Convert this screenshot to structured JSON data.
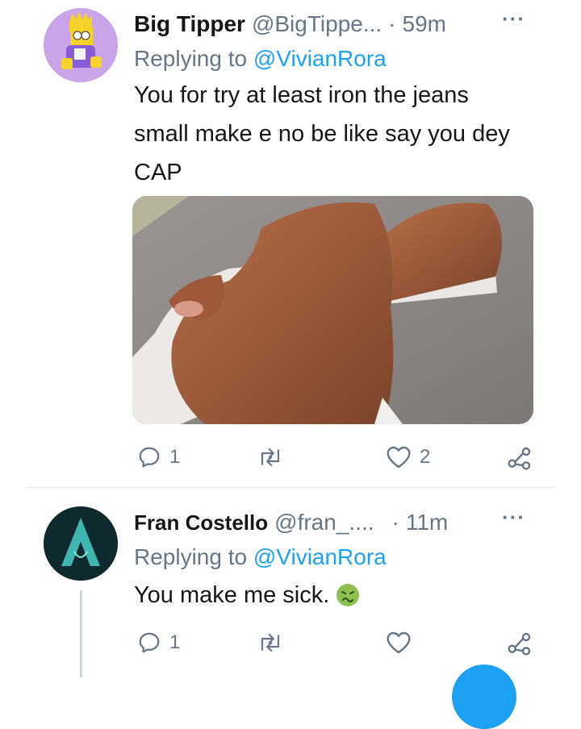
{
  "tweet1": {
    "display_name": "Big Tipper",
    "handle": "@BigTippe...",
    "separator": "·",
    "time": "59m",
    "more": "···",
    "replying_prefix": "Replying to",
    "replying_to": "@VivianRora",
    "text": "You for try at least iron the jeans small make e no be like say you dey CAP",
    "reply_count": "1",
    "like_count": "2",
    "avatar_icon": "bart-character-icon"
  },
  "tweet2": {
    "display_name": "Fran Costello",
    "handle": "@fran_....",
    "separator": "·",
    "time": "11m",
    "more": "···",
    "replying_prefix": "Replying to",
    "replying_to": "@VivianRora",
    "text": "You make me sick.",
    "emoji": "nauseated-face-icon",
    "reply_count": "1",
    "avatar_icon": "assassin-creed-logo-icon"
  },
  "colors": {
    "accent": "#1da1f2",
    "secondary_text": "#657786",
    "divider": "#e1e8ed",
    "avatar1_bg": "#c9a4e8",
    "avatar2_bg": "#0f2a2e"
  }
}
